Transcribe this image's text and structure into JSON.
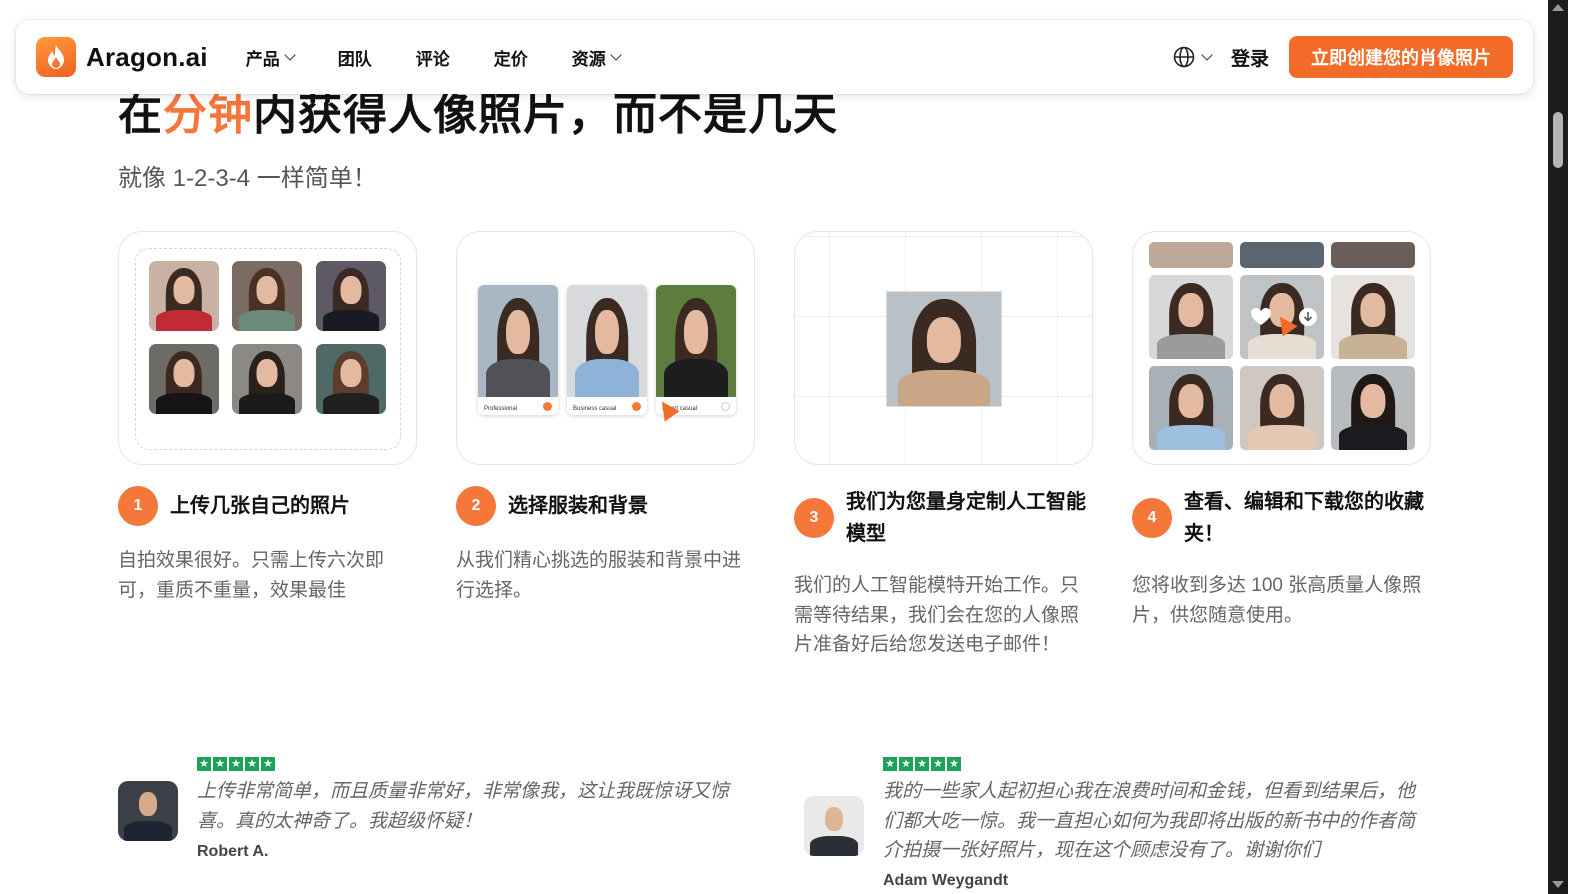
{
  "nav": {
    "brand": "Aragon.ai",
    "items": [
      {
        "label": "产品",
        "has_dropdown": true
      },
      {
        "label": "团队",
        "has_dropdown": false
      },
      {
        "label": "评论",
        "has_dropdown": false
      },
      {
        "label": "定价",
        "has_dropdown": false
      },
      {
        "label": "资源",
        "has_dropdown": true
      }
    ],
    "language_icon": "globe-icon",
    "login": "登录",
    "cta": "立即创建您的肖像照片"
  },
  "hero": {
    "title_part1": "在",
    "title_accent": "分钟",
    "title_part2": "内获得人像照片，而不是几天",
    "subtitle": "就像 1-2-3-4 一样简单！"
  },
  "steps": [
    {
      "number": "1",
      "title": "上传几张自己的照片",
      "desc": "自拍效果很好。只需上传六次即可，重质不重量，效果最佳"
    },
    {
      "number": "2",
      "title": "选择服装和背景",
      "desc": "从我们精心挑选的服装和背景中进行选择。",
      "outfits": [
        "Professional",
        "Business casual",
        "Smart casual"
      ]
    },
    {
      "number": "3",
      "title": "我们为您量身定制人工智能模型",
      "desc": "我们的人工智能模特开始工作。只需等待结果，我们会在您的人像照片准备好后给您发送电子邮件！"
    },
    {
      "number": "4",
      "title": "查看、编辑和下载您的收藏夹！",
      "desc": "您将收到多达 100 张高质量人像照片，供您随意使用。"
    }
  ],
  "reviews": [
    {
      "rating": 5,
      "quote": "上传非常简单，而且质量非常好，非常像我，这让我既惊讶又惊喜。真的太神奇了。我超级怀疑！",
      "author": "Robert A."
    },
    {
      "rating": 5,
      "quote": "我的一些家人起初担心我在浪费时间和金钱，但看到结果后，他们都大吃一惊。我一直担心如何为我即将出版的新书中的作者简介拍摄一张好照片，现在这个顾虑没有了。谢谢你们",
      "author": "Adam Weygandt"
    }
  ],
  "colors": {
    "accent": "#f26b28",
    "step_number": "#f6773a",
    "stars": "#1aa35a",
    "scrollbar_track": "#1c1c1c"
  }
}
